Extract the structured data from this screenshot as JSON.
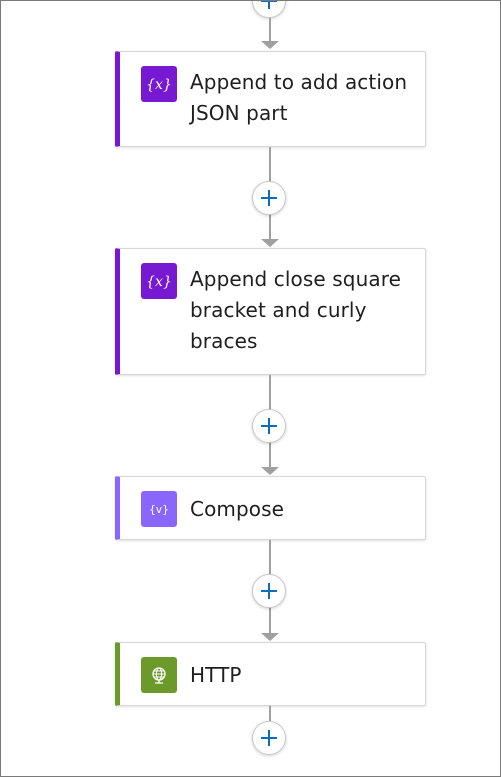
{
  "flow": {
    "steps": [
      {
        "title": "Append to add action JSON part",
        "icon": "variable-icon",
        "accent": "#7719d2",
        "icon_bg": "#7719d2",
        "icon_text": "{x}"
      },
      {
        "title": "Append close square bracket and curly braces",
        "icon": "variable-icon",
        "accent": "#7719d2",
        "icon_bg": "#7719d2",
        "icon_text": "{x}"
      },
      {
        "title": "Compose",
        "icon": "compose-icon",
        "accent": "#8a66ff",
        "icon_bg": "#8a66ff",
        "icon_text": "{v}"
      },
      {
        "title": "HTTP",
        "icon": "http-globe-icon",
        "accent": "#6b9a2b",
        "icon_bg": "#6b9a2b",
        "icon_text": ""
      }
    ],
    "add_button_label": "+"
  },
  "colors": {
    "connector": "#a0a0a0",
    "add_plus": "#0f6cbd"
  }
}
